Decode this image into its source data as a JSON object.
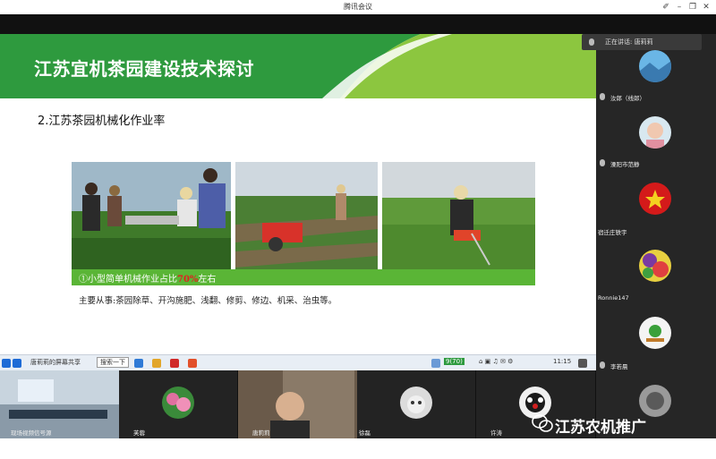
{
  "app": {
    "title": "腾讯会议"
  },
  "slide": {
    "title": "江苏宜机茶园建设技术探讨",
    "section": "2.江苏茶园机械化作业率",
    "caption_prefix": "①小型简单机械作业占比",
    "caption_highlight": "70%",
    "caption_suffix": "左右",
    "description": "主要从事:茶园除草、开沟施肥、浅翻、修剪、修边、机采、治虫等。"
  },
  "taskbar": {
    "search_label": "搜索一下",
    "wifi": "9(70)",
    "time": "11:15",
    "left_label": "唐莉莉的屏幕共享"
  },
  "speaking": {
    "label": "正在讲话: 唐莉莉"
  },
  "participants": [
    {
      "name": "汝郎（线郎）"
    },
    {
      "name": "溧阳市范静"
    },
    {
      "name": "宿迁庄轶宇"
    },
    {
      "name": "Ronnie147"
    },
    {
      "name": "李若晨"
    }
  ],
  "bottom_tiles": [
    {
      "name": "现场视频信号源"
    },
    {
      "name": "芙蓉"
    },
    {
      "name": "唐莉莉"
    },
    {
      "name": "徐磊"
    },
    {
      "name": "许涛"
    }
  ],
  "watermark": {
    "text": "江苏农机推广"
  },
  "colors": {
    "green_dark": "#2e9a3e",
    "green_light": "#8cc63f",
    "caption_green": "#5ab536",
    "highlight": "#e02020"
  }
}
